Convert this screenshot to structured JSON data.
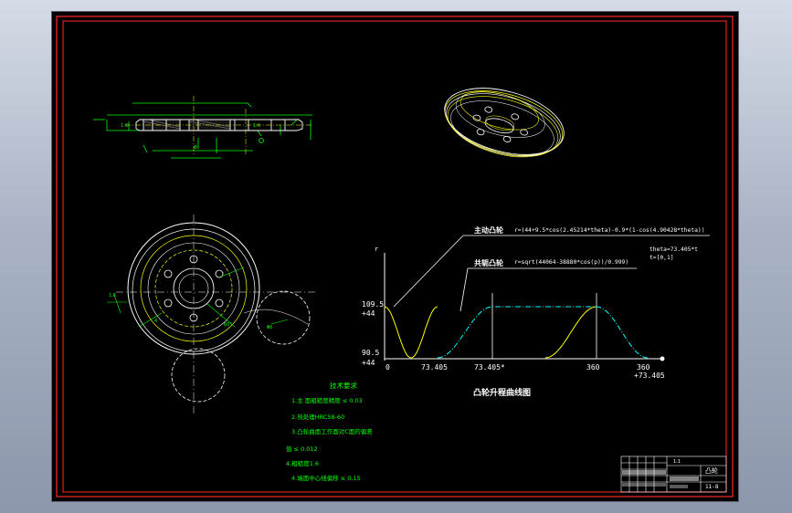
{
  "formula_profile": {
    "driving_cam_label": "主动凸轮",
    "driving_cam_formula": "r=(44+9.5*cos(2.45214*theta)-0.9*(1-cos(4.90428*theta))",
    "conjugate_cam_label": "共轭凸轮",
    "conjugate_cam_formula": "r=sqrt(44064-38880*cos(p))/0.999)",
    "theta_note_line1": "theta=73.405*t",
    "theta_note_line2": "t=[0,1]"
  },
  "chart_data": {
    "type": "line",
    "title": "凸轮升程曲线图",
    "ylabel": "r",
    "y_tick_labels": [
      {
        "value": "109.5",
        "sub": "+44"
      },
      {
        "value": "90.5",
        "sub": "+44"
      }
    ],
    "x_tick_labels": [
      {
        "value": "0",
        "sub": ""
      },
      {
        "value": "73.405",
        "sub": ""
      },
      {
        "value": "73.405*",
        "sub": ""
      },
      {
        "value": "360",
        "sub": ""
      },
      {
        "value": "360",
        "sub": "+73.405"
      }
    ],
    "series": [
      {
        "color": "#ffff00",
        "style": "solid"
      },
      {
        "color": "#00ffff",
        "style": "dash-dot"
      }
    ]
  },
  "tech_notes": {
    "heading": "技术要求",
    "items": [
      "1.主 面粗糙度精度 ≤ 0.03",
      "2.热处理HRC58-60",
      "3.凸轮曲面工作面对C面的偏差",
      "值 ≤ 0.012",
      "4.粗糙度1.6",
      "4.端面中心线偏移 ≤ 0.15"
    ]
  },
  "title_block": {
    "drawing_name": "凸轮",
    "scale": "1:1",
    "drawing_number": "11-8"
  },
  "colors": {
    "frame_red": "#ff2a2a",
    "line_white": "#ffffff",
    "cam_yellow": "#ffff00",
    "dim_green": "#00ff00",
    "follower_cyan": "#00ffff"
  }
}
